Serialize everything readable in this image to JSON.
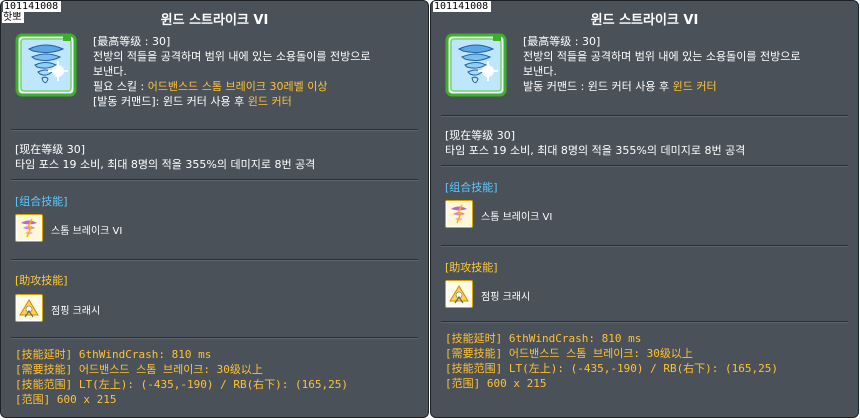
{
  "left": {
    "id": "101141008",
    "subtag": "핫뽀",
    "title": "윈드 스트라이크 VI",
    "desc": [
      "[最高等级 : 30]",
      "전방의 적들을 공격하며 범위 내에 있는 소용돌이를 전방으로",
      "보낸다."
    ],
    "req_prefix": "필요 스킬 : ",
    "req_skill": "어드밴스드 스톰 브레이크 30레벨 이상",
    "cmd_prefix": "[발동 커맨드]: 윈드 커터 사용 후 ",
    "cmd_skill": "윈드 커터",
    "level_head": "[现在等级 30]",
    "level_text": "타임 포스 19 소비, 최대 8명의 적을 355%의 데미지로 8번 공격",
    "combo_head": "[组合技能]",
    "combo_skill": "스톰 브레이크 VI",
    "assist_head": "[助攻技能]",
    "assist_skill": "점핑 크래시",
    "info": [
      "[技能延时] 6thWindCrash: 810 ms",
      "[需要技能] 어드밴스드 스톰 브레이크: 30级以上",
      "[技能范围] LT(左上): (-435,-190) / RB(右下): (165,25)",
      "[范围] 600 x 215"
    ]
  },
  "right": {
    "id": "101141008",
    "title": "윈드 스트라이크 VI",
    "desc": [
      "[最高等级 : 30]",
      "전방의 적들을 공격하며 범위 내에 있는 소용돌이를 전방으로",
      "보낸다."
    ],
    "cmd_prefix": "발동 커맨드 : 윈드 커터 사용 후 ",
    "cmd_skill": "윈드 커터",
    "level_head": "[现在等级 30]",
    "level_text": "타임 포스 19 소비, 최대 8명의 적을 355%의 데미지로 8번 공격",
    "combo_head": "[组合技能]",
    "combo_skill": "스톰 브레이크 VI",
    "assist_head": "[助攻技能]",
    "assist_skill": "점핑 크래시",
    "info": [
      "[技能延时] 6thWindCrash: 810 ms",
      "[需要技能] 어드밴스드 스톰 브레이크: 30级以上",
      "[技能范围] LT(左上): (-435,-190) / RB(右下): (165,25)",
      "[范围] 600 x 215"
    ]
  },
  "colors": {
    "panel_bg": "#4a5159",
    "orange": "#ffc233",
    "blue_heading": "#5ec8ff",
    "yellow_heading": "#ffcc33"
  },
  "icons": {
    "main": "tornado-skill-icon",
    "combo": "storm-break-icon",
    "assist": "jumping-crash-icon"
  }
}
